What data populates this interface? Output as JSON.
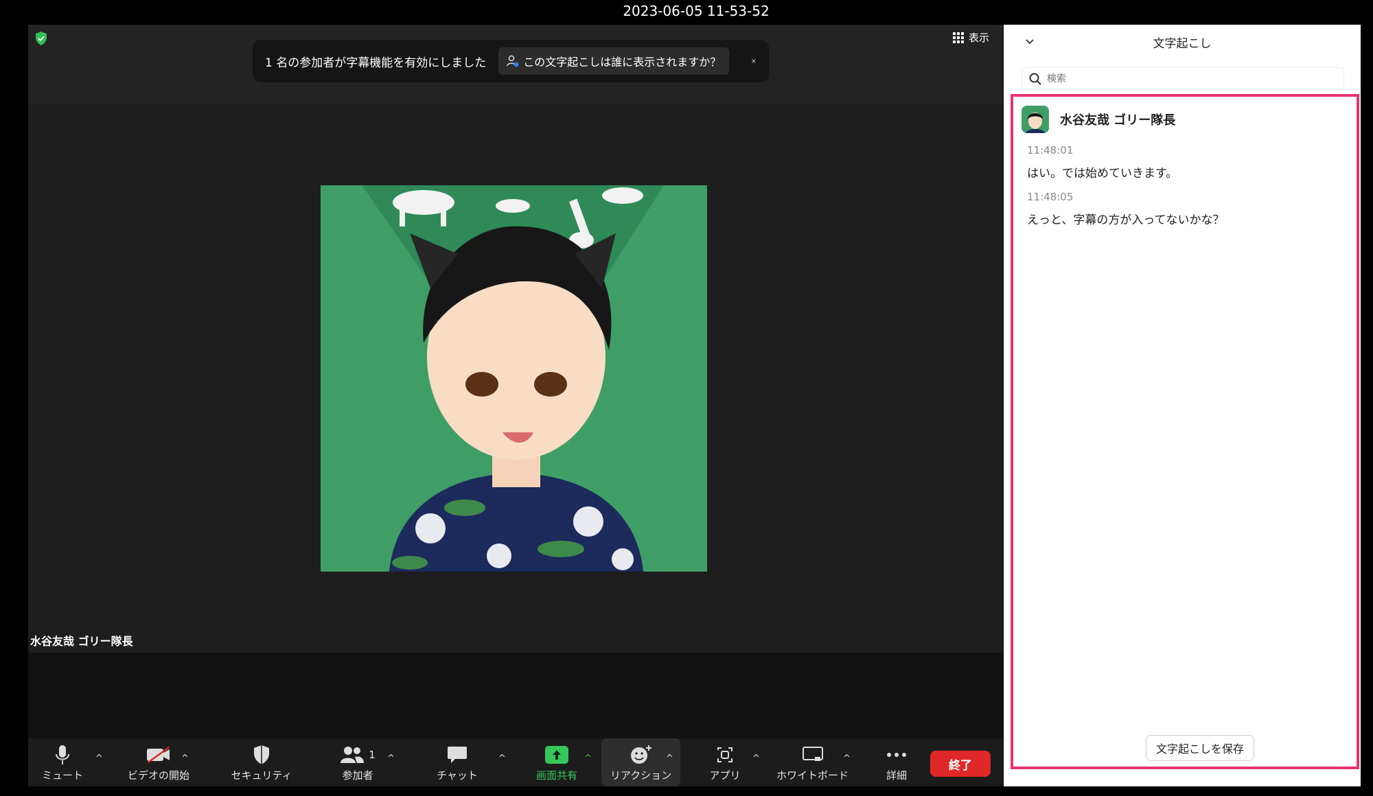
{
  "window": {
    "timestamp": "2023-06-05 11-53-52"
  },
  "meeting": {
    "view_label": "表示",
    "notice_text": "1 名の参加者が字幕機能を有効にしました",
    "notice_link": "この文字起こしは誰に表示されますか？",
    "participant_name": "水谷友哉 ゴリー隊長"
  },
  "toolbar": {
    "mute": "ミュート",
    "video": "ビデオの開始",
    "security": "セキュリティ",
    "participants": "参加者",
    "participants_count": "1",
    "chat": "チャット",
    "share": "画面共有",
    "reaction": "リアクション",
    "apps": "アプリ",
    "whiteboard": "ホワイトボード",
    "more": "詳細",
    "end": "終了"
  },
  "transcript": {
    "title": "文字起こし",
    "search_placeholder": "検索",
    "speaker": "水谷友哉 ゴリー隊長",
    "entries": [
      {
        "time": "11:48:01",
        "text": "はい。では始めていきます。"
      },
      {
        "time": "11:48:05",
        "text": "えっと、字幕の方が入ってないかな？"
      }
    ],
    "save_label": "文字起こしを保存"
  },
  "colors": {
    "accent_green": "#35c759",
    "end_red": "#e02828",
    "highlight_pink": "#e8336f",
    "video_bg": "#3f9e66"
  }
}
